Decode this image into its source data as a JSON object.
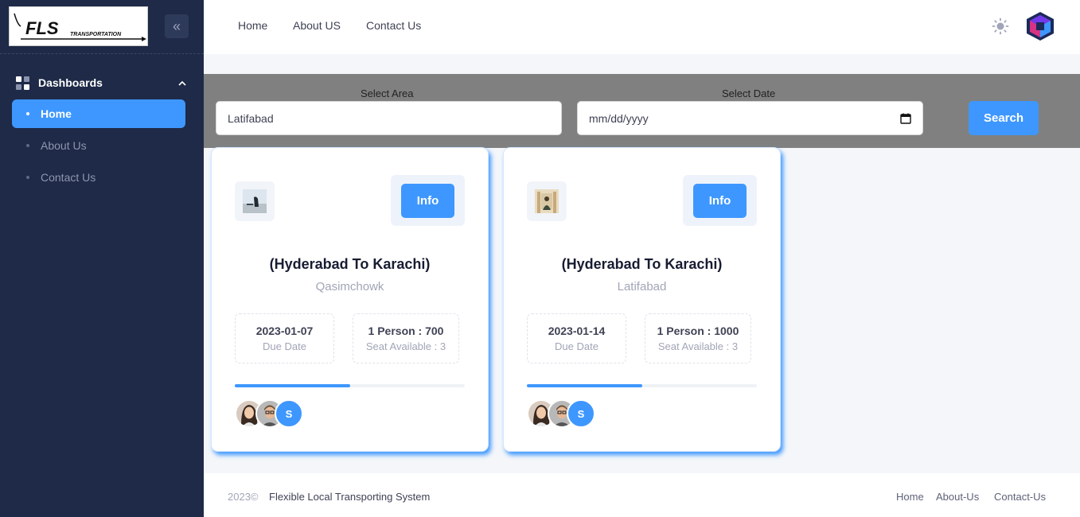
{
  "brand": {
    "logo_text": "FLS",
    "logo_tagline": "TRANSPORTATION"
  },
  "sidebar": {
    "section_label": "Dashboards",
    "items": [
      {
        "label": "Home",
        "active": true
      },
      {
        "label": "About Us",
        "active": false
      },
      {
        "label": "Contact Us",
        "active": false
      }
    ]
  },
  "header": {
    "links": [
      "Home",
      "About US",
      "Contact Us"
    ]
  },
  "search": {
    "area_label": "Select Area",
    "area_value": "Latifabad",
    "date_label": "Select Date",
    "date_placeholder": "mm/dd/yyyy",
    "button_label": "Search"
  },
  "cards": [
    {
      "info_label": "Info",
      "title": "(Hyderabad To Karachi)",
      "subtitle": "Qasimchowk",
      "date": "2023-01-07",
      "date_label": "Due Date",
      "price": "1 Person : 700",
      "seats": "Seat Available : 3",
      "progress": 0.5,
      "avatar_letter": "S"
    },
    {
      "info_label": "Info",
      "title": "(Hyderabad To Karachi)",
      "subtitle": "Latifabad",
      "date": "2023-01-14",
      "date_label": "Due Date",
      "price": "1 Person : 1000",
      "seats": "Seat Available : 3",
      "progress": 0.5,
      "avatar_letter": "S"
    }
  ],
  "footer": {
    "year": "2023©",
    "name": "Flexible Local Transporting System",
    "links": [
      "Home",
      "About-Us",
      "Contact-Us"
    ]
  },
  "colors": {
    "primary": "#3e97ff",
    "sidebar": "#1e2a47",
    "band": "#808080"
  }
}
